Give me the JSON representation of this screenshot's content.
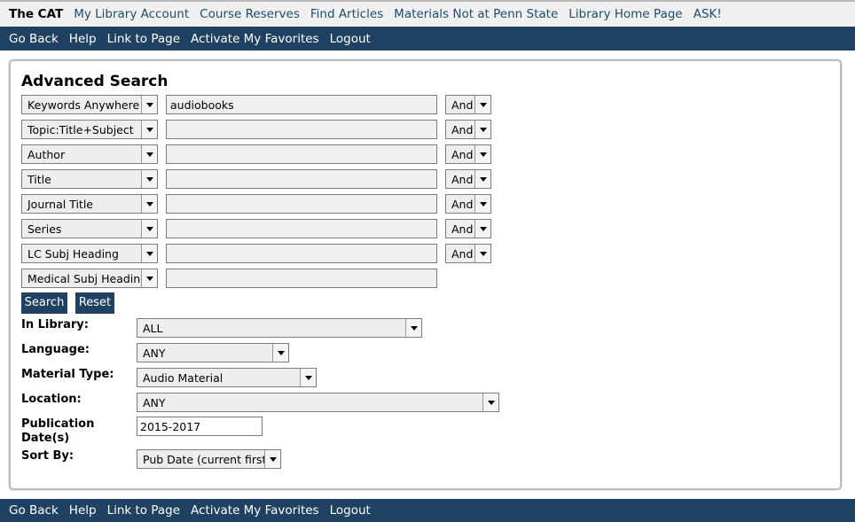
{
  "topbar": {
    "home": "The CAT",
    "links": [
      "My Library Account",
      "Course Reserves",
      "Find Articles",
      "Materials Not at Penn State",
      "Library Home Page",
      "ASK!"
    ]
  },
  "nav": {
    "items": [
      "Go Back",
      "Help",
      "Link to Page",
      "Activate My Favorites",
      "Logout"
    ]
  },
  "form": {
    "title": "Advanced Search",
    "rows": [
      {
        "field": "Keywords Anywhere",
        "value": "audiobooks",
        "op": "And"
      },
      {
        "field": "Topic:Title+Subject",
        "value": "",
        "op": "And"
      },
      {
        "field": "Author",
        "value": "",
        "op": "And"
      },
      {
        "field": "Title",
        "value": "",
        "op": "And"
      },
      {
        "field": "Journal Title",
        "value": "",
        "op": "And"
      },
      {
        "field": "Series",
        "value": "",
        "op": "And"
      },
      {
        "field": "LC Subj Heading",
        "value": "",
        "op": "And"
      },
      {
        "field": "Medical Subj Heading",
        "value": ""
      }
    ],
    "search_label": "Search",
    "reset_label": "Reset",
    "library_label": "In Library:",
    "library_value": "ALL",
    "language_label": "Language:",
    "language_value": "ANY",
    "material_label": "Material Type:",
    "material_value": "Audio Material",
    "location_label": "Location:",
    "location_value": "ANY",
    "pubdate_label": "Publication Date(s)",
    "pubdate_value": "2015-2017",
    "sort_label": "Sort By:",
    "sort_value": "Pub Date (current first)"
  }
}
